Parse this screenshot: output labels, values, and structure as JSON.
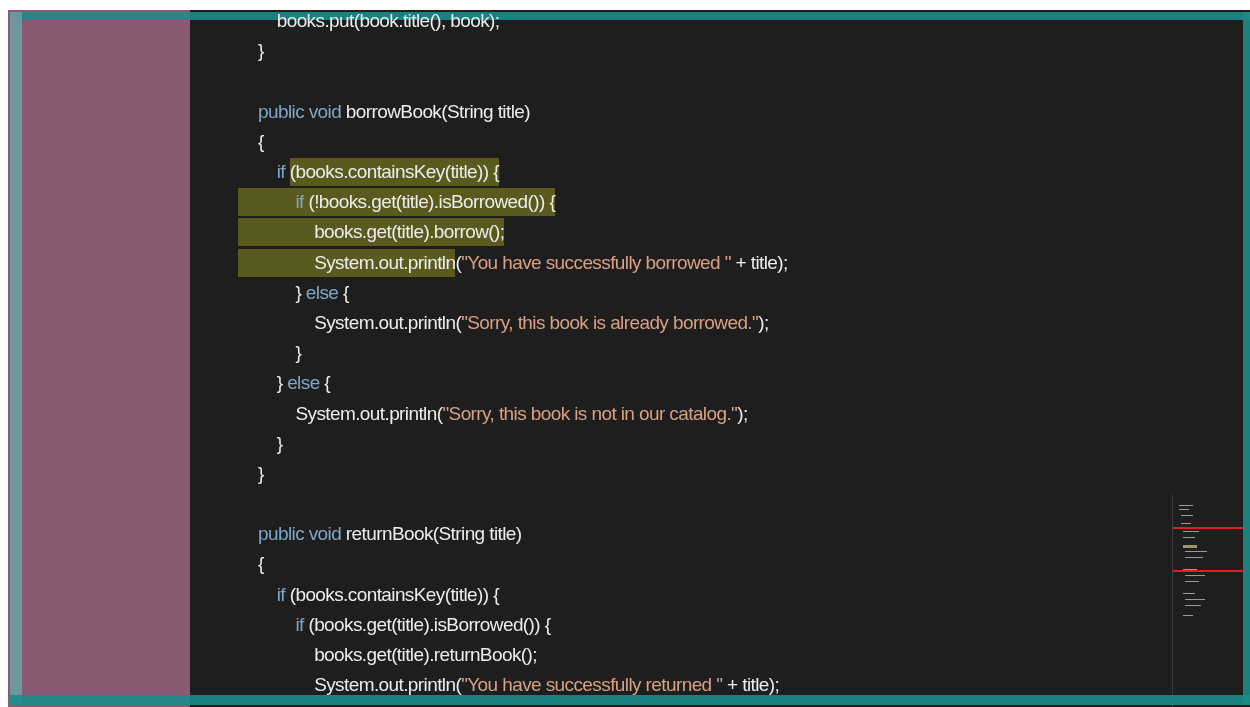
{
  "editor": {
    "lines": [
      {
        "kind": "code",
        "tokens": [
          {
            "kind": "plain",
            "text": "    books.put(book.title(), book);",
            "selected": false
          }
        ]
      },
      {
        "kind": "code",
        "tokens": [
          {
            "kind": "plain",
            "text": "}",
            "selected": false
          }
        ]
      },
      {
        "kind": "blank"
      },
      {
        "kind": "code",
        "tokens": [
          {
            "kind": "keyword",
            "text": "public void",
            "selected": false
          },
          {
            "kind": "plain",
            "text": " borrowBook(String title)",
            "selected": false
          }
        ]
      },
      {
        "kind": "code",
        "tokens": [
          {
            "kind": "plain",
            "text": "{",
            "selected": false
          }
        ]
      },
      {
        "kind": "code",
        "tokens": [
          {
            "kind": "keyword",
            "text": "    if ",
            "selected": false
          },
          {
            "kind": "plain",
            "text": "(books.containsKey(title)) {",
            "selected": true
          }
        ]
      },
      {
        "kind": "code",
        "tokens": [
          {
            "kind": "keyword",
            "text": "        if",
            "selected": true
          },
          {
            "kind": "plain",
            "text": " (!books.get(title).isBorrowed()) {",
            "selected": true
          }
        ]
      },
      {
        "kind": "code",
        "tokens": [
          {
            "kind": "plain",
            "text": "            books.get(title).borrow();",
            "selected": true
          }
        ]
      },
      {
        "kind": "code",
        "tokens": [
          {
            "kind": "plain",
            "text": "            System.out.println",
            "selected": true
          },
          {
            "kind": "plain",
            "text": "(",
            "selected": false
          },
          {
            "kind": "string",
            "text": "\"You have successfully borrowed \"",
            "selected": false
          },
          {
            "kind": "plain",
            "text": " + title);",
            "selected": false
          }
        ]
      },
      {
        "kind": "code",
        "tokens": [
          {
            "kind": "plain",
            "text": "        } ",
            "selected": false
          },
          {
            "kind": "keyword",
            "text": "else",
            "selected": false
          },
          {
            "kind": "plain",
            "text": " {",
            "selected": false
          }
        ]
      },
      {
        "kind": "code",
        "tokens": [
          {
            "kind": "plain",
            "text": "            System.out.println(",
            "selected": false
          },
          {
            "kind": "string",
            "text": "\"Sorry, this book is already borrowed.\"",
            "selected": false
          },
          {
            "kind": "plain",
            "text": ");",
            "selected": false
          }
        ]
      },
      {
        "kind": "code",
        "tokens": [
          {
            "kind": "plain",
            "text": "        }",
            "selected": false
          }
        ]
      },
      {
        "kind": "code",
        "tokens": [
          {
            "kind": "plain",
            "text": "    } ",
            "selected": false
          },
          {
            "kind": "keyword",
            "text": "else",
            "selected": false
          },
          {
            "kind": "plain",
            "text": " {",
            "selected": false
          }
        ]
      },
      {
        "kind": "code",
        "tokens": [
          {
            "kind": "plain",
            "text": "        System.out.println(",
            "selected": false
          },
          {
            "kind": "string",
            "text": "\"Sorry, this book is not in our catalog.\"",
            "selected": false
          },
          {
            "kind": "plain",
            "text": ");",
            "selected": false
          }
        ]
      },
      {
        "kind": "code",
        "tokens": [
          {
            "kind": "plain",
            "text": "    }",
            "selected": false
          }
        ]
      },
      {
        "kind": "code",
        "tokens": [
          {
            "kind": "plain",
            "text": "}",
            "selected": false
          }
        ]
      },
      {
        "kind": "blank"
      },
      {
        "kind": "code",
        "tokens": [
          {
            "kind": "keyword",
            "text": "public void",
            "selected": false
          },
          {
            "kind": "plain",
            "text": " returnBook(String title)",
            "selected": false
          }
        ]
      },
      {
        "kind": "code",
        "tokens": [
          {
            "kind": "plain",
            "text": "{",
            "selected": false
          }
        ]
      },
      {
        "kind": "code",
        "tokens": [
          {
            "kind": "keyword",
            "text": "    if",
            "selected": false
          },
          {
            "kind": "plain",
            "text": " (books.containsKey(title)) {",
            "selected": false
          }
        ]
      },
      {
        "kind": "code",
        "tokens": [
          {
            "kind": "keyword",
            "text": "        if",
            "selected": false
          },
          {
            "kind": "plain",
            "text": " (books.get(title).isBorrowed()) {",
            "selected": false
          }
        ]
      },
      {
        "kind": "code",
        "tokens": [
          {
            "kind": "plain",
            "text": "            books.get(title).returnBook();",
            "selected": false
          }
        ]
      },
      {
        "kind": "code",
        "tokens": [
          {
            "kind": "plain",
            "text": "            System.out.println(",
            "selected": false
          },
          {
            "kind": "string",
            "text": "\"You have successfully returned \"",
            "selected": false
          },
          {
            "kind": "plain",
            "text": " + title);",
            "selected": false
          }
        ]
      }
    ]
  }
}
